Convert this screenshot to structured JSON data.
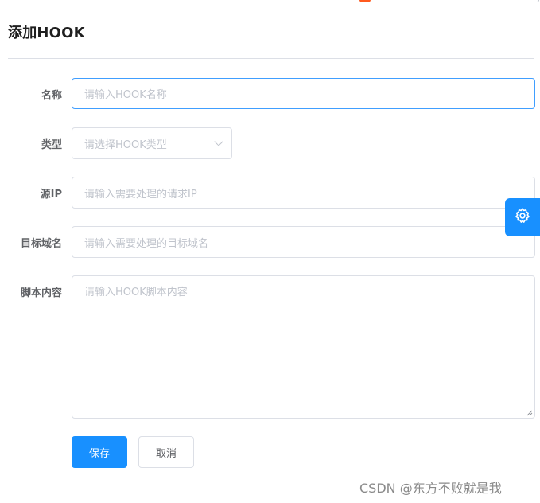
{
  "dialog": {
    "title": "添加HOOK"
  },
  "form": {
    "name": {
      "label": "名称",
      "placeholder": "请输入HOOK名称",
      "value": ""
    },
    "type": {
      "label": "类型",
      "placeholder": "请选择HOOK类型",
      "value": ""
    },
    "source_ip": {
      "label": "源IP",
      "placeholder": "请输入需要处理的请求IP",
      "value": ""
    },
    "target_domain": {
      "label": "目标域名",
      "placeholder": "请输入需要处理的目标域名",
      "value": ""
    },
    "script": {
      "label": "脚本内容",
      "placeholder": "请输入HOOK脚本内容",
      "value": ""
    }
  },
  "actions": {
    "save_label": "保存",
    "cancel_label": "取消"
  },
  "icons": {
    "settings": "gear-icon",
    "select_arrow": "chevron-down-icon"
  },
  "colors": {
    "primary": "#1890ff",
    "focus_border": "#409eff",
    "border": "#dcdfe6",
    "placeholder": "#c0c4cc"
  },
  "watermark": "CSDN @东方不败就是我"
}
